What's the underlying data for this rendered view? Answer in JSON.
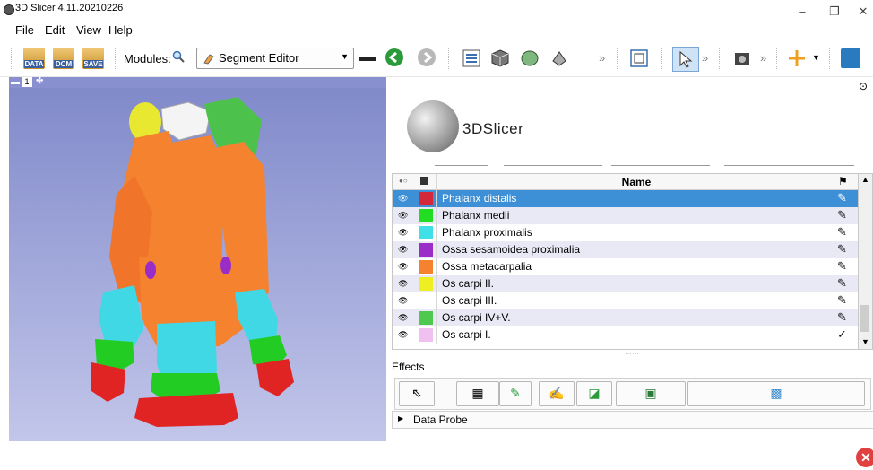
{
  "window": {
    "title": "3D Slicer 4.11.20210226",
    "minimize_icon": "–",
    "restore_icon": "❐",
    "close_icon": "✕"
  },
  "menu": [
    "File",
    "Edit",
    "View",
    "Help"
  ],
  "toolbar": {
    "data_label": "DATA",
    "dcm_label": "DCM",
    "save_label": "SAVE",
    "modules_label": "Modules:",
    "module_selected": "Segment Editor",
    "overflow": "»"
  },
  "view3d": {
    "number": "1",
    "pin": "▬",
    "crosshair": "✤"
  },
  "slicer_logo_text": "3DSlicer",
  "segments": {
    "header": {
      "name": "Name"
    },
    "rows": [
      {
        "name": "Phalanx distalis",
        "color": "#d4283a",
        "selected": true
      },
      {
        "name": "Phalanx medii",
        "color": "#22dd22",
        "selected": false
      },
      {
        "name": "Phalanx proximalis",
        "color": "#40e0e8",
        "selected": false
      },
      {
        "name": "Ossa sesamoidea proximalia",
        "color": "#9a2cc8",
        "selected": false
      },
      {
        "name": "Ossa metacarpalia",
        "color": "#f4822e",
        "selected": false
      },
      {
        "name": "Os carpi II.",
        "color": "#eeee22",
        "selected": false
      },
      {
        "name": "Os carpi III.",
        "color": "#ffffff",
        "selected": false
      },
      {
        "name": "Os carpi IV+V.",
        "color": "#4ec84e",
        "selected": false
      },
      {
        "name": "Os carpi I.",
        "color": "#f0c0f0",
        "selected": false
      }
    ]
  },
  "effects_label": "Effects",
  "data_probe_label": "Data Probe",
  "colors": {
    "selection": "#3d8fd6",
    "row_alt": "#e9e9f6",
    "view_top": "#7f88c9",
    "view_bottom": "#c2c6ea"
  }
}
